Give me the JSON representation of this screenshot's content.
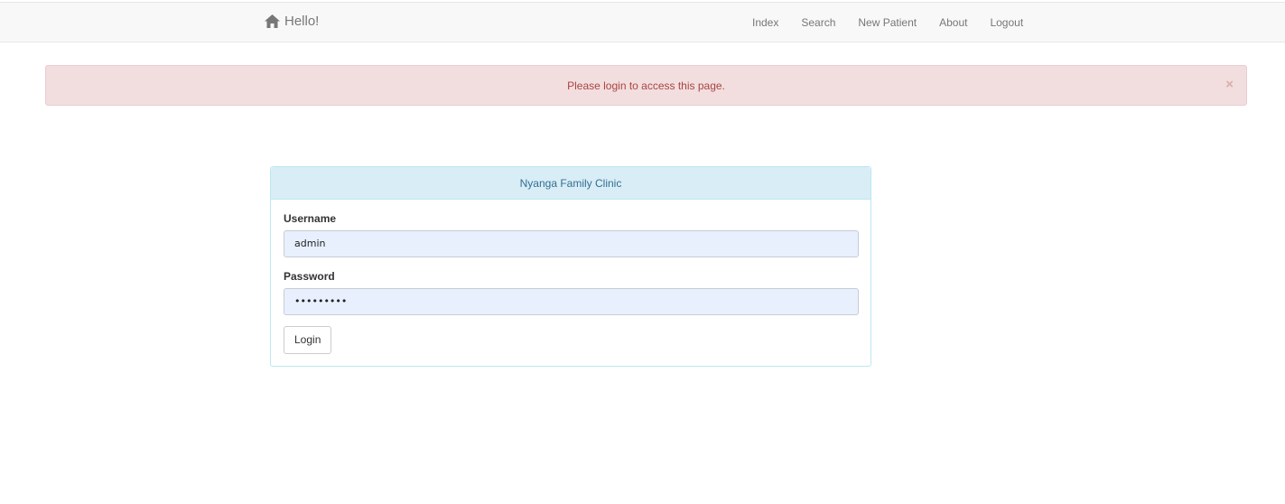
{
  "navbar": {
    "brand_label": "Hello!",
    "brand_icon": "home-icon",
    "links": [
      {
        "label": "Index"
      },
      {
        "label": "Search"
      },
      {
        "label": "New Patient"
      },
      {
        "label": "About"
      },
      {
        "label": "Logout"
      }
    ]
  },
  "alert": {
    "message": "Please login to access this page.",
    "close_label": "×"
  },
  "login_panel": {
    "title": "Nyanga Family Clinic",
    "username_label": "Username",
    "username_value": "admin",
    "password_label": "Password",
    "password_value": "•••••••••",
    "submit_label": "Login"
  },
  "colors": {
    "alert_bg": "#f2dede",
    "alert_text": "#a94442",
    "panel_heading_bg": "#d9edf7",
    "input_autofill_bg": "#e8f0fe"
  }
}
